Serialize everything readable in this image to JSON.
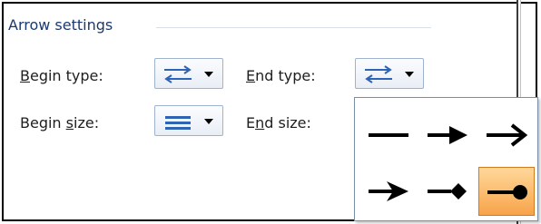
{
  "section": {
    "title": "Arrow settings"
  },
  "fields": {
    "begin_type": {
      "label_prefix": "",
      "label_ul": "B",
      "label_rest": "egin type:"
    },
    "end_type": {
      "label_prefix": "",
      "label_ul": "E",
      "label_rest": "nd type:"
    },
    "begin_size": {
      "label_prefix": "Begin ",
      "label_ul": "s",
      "label_rest": "ize:"
    },
    "end_size": {
      "label_prefix": "E",
      "label_ul": "n",
      "label_rest": "d size:"
    }
  },
  "dropdown_icons": {
    "begin_type": "arrow-types-icon",
    "end_type": "arrow-types-icon",
    "begin_size": "line-sizes-icon"
  },
  "popup": {
    "options": [
      "line-plain-icon",
      "arrow-triangle-icon",
      "arrow-open-icon",
      "arrow-stealth-icon",
      "arrow-diamond-icon",
      "arrow-oval-icon"
    ],
    "selected_index": 5
  },
  "colors": {
    "accent_blue": "#2f64b4",
    "selected_orange": "#f7a34a",
    "title_blue": "#1c3a6e"
  }
}
